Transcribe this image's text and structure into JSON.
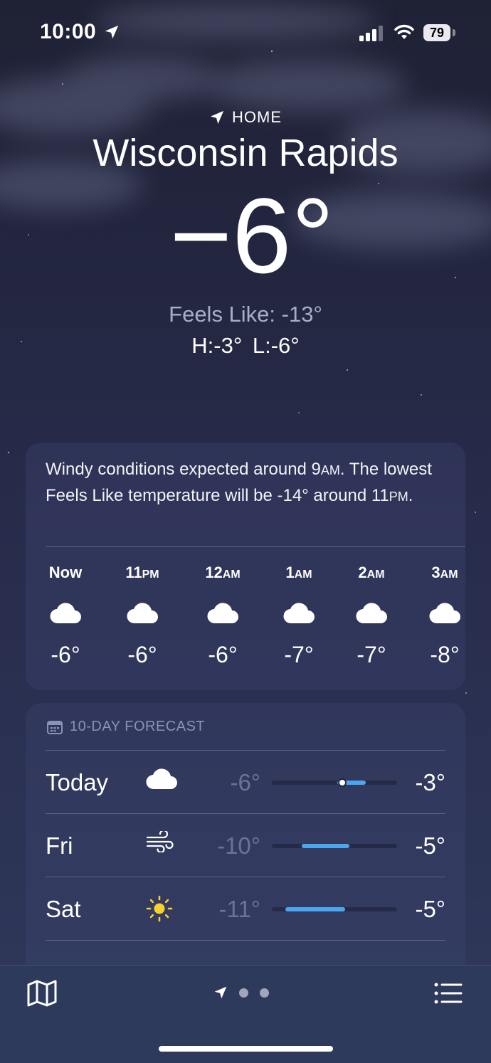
{
  "status_bar": {
    "time": "10:00",
    "battery": "79",
    "icons": [
      "location-arrow-icon",
      "cellular-signal-icon",
      "wifi-icon",
      "battery-icon"
    ]
  },
  "header": {
    "location_label": "HOME",
    "city": "Wisconsin Rapids",
    "temperature": "−6°",
    "feels_like": "Feels Like: -13°",
    "high_low": "H:-3°  L:-6°"
  },
  "hourly": {
    "summary_parts": [
      "Windy conditions expected around 9",
      "AM",
      ". The lowest Feels Like temperature will be -14° around 11",
      "PM",
      "."
    ],
    "hours": [
      {
        "label": "Now",
        "suffix": "",
        "icon": "cloud-icon",
        "temp": "-6°"
      },
      {
        "label": "11",
        "suffix": "PM",
        "icon": "cloud-icon",
        "temp": "-6°"
      },
      {
        "label": "12",
        "suffix": "AM",
        "icon": "cloud-icon",
        "temp": "-6°"
      },
      {
        "label": "1",
        "suffix": "AM",
        "icon": "cloud-icon",
        "temp": "-7°"
      },
      {
        "label": "2",
        "suffix": "AM",
        "icon": "cloud-icon",
        "temp": "-7°"
      },
      {
        "label": "3",
        "suffix": "AM",
        "icon": "cloud-icon",
        "temp": "-8°"
      }
    ]
  },
  "ten_day": {
    "title": "10-DAY FORECAST",
    "icon": "calendar-icon",
    "days": [
      {
        "day": "Today",
        "icon": "cloud-icon",
        "low": "-6°",
        "high": "-3°",
        "bar_start": 0.52,
        "bar_end": 0.75,
        "current_position": 0.56
      },
      {
        "day": "Fri",
        "icon": "wind-icon",
        "low": "-10°",
        "high": "-5°",
        "bar_start": 0.24,
        "bar_end": 0.62
      },
      {
        "day": "Sat",
        "icon": "sun-icon",
        "low": "-11°",
        "high": "-5°",
        "bar_start": 0.11,
        "bar_end": 0.59
      }
    ],
    "range_bar_color": "#4aa6ef"
  },
  "tab_bar": {
    "map_icon": "map-icon",
    "current_page_icon": "location-arrow-icon",
    "pages": 3,
    "list_icon": "list-icon"
  }
}
